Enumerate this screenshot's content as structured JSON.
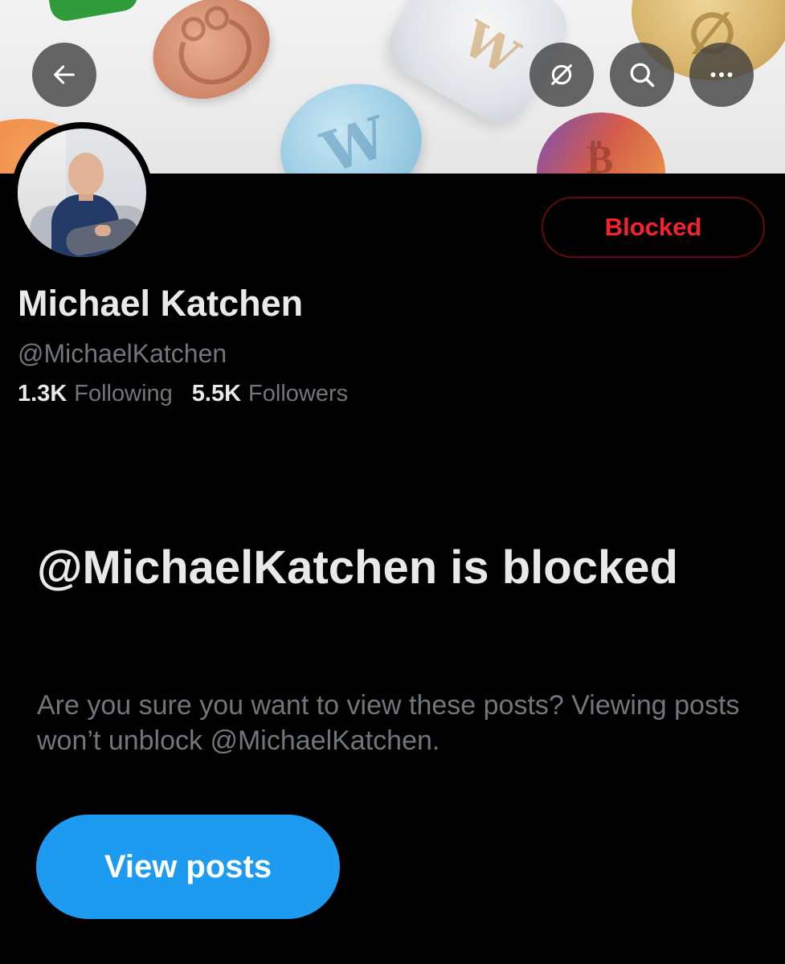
{
  "header": {
    "back_icon": "arrow-left-icon",
    "grok_icon": "grok-icon",
    "search_icon": "search-icon",
    "more_icon": "more-horizontal-icon"
  },
  "banner": {
    "description_colors": {
      "green": "#2f9b3a",
      "pink": "#d28a6c",
      "blue": "#9fcfe6",
      "gold": "#d8b56c",
      "orange": "#ec7c35"
    }
  },
  "profile": {
    "display_name": "Michael Katchen",
    "handle": "@MichaelKatchen",
    "following_count": "1.3K",
    "following_label": "Following",
    "followers_count": "5.5K",
    "followers_label": "Followers",
    "blocked_button_label": "Blocked"
  },
  "blocked_notice": {
    "title": "@MichaelKatchen is blocked",
    "description": "Are you sure you want to view these posts? Viewing posts won’t unblock @MichaelKatchen.",
    "view_posts_label": "View posts"
  },
  "colors": {
    "background": "#000000",
    "primary_text": "#e7e9ea",
    "secondary_text": "#71767b",
    "blocked_red": "#f4212e",
    "blocked_border": "#67070f",
    "accent_blue": "#1d9bf0"
  }
}
